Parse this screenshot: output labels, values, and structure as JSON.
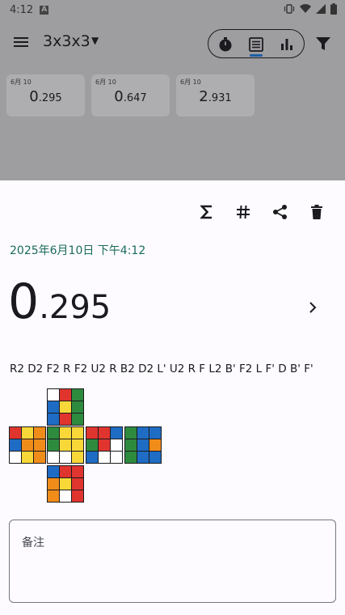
{
  "status_bar": {
    "time": "4:12",
    "notif_letter": "A"
  },
  "top_bar": {
    "puzzle": "3x3x3"
  },
  "history_cards": [
    {
      "date": "6月 10",
      "int": "0",
      "dec": ".295"
    },
    {
      "date": "6月 10",
      "int": "0",
      "dec": ".647"
    },
    {
      "date": "6月 10",
      "int": "2",
      "dec": ".931"
    }
  ],
  "solve": {
    "date": "2025年6月10日 下午4:12",
    "time_int": "0",
    "time_dec": ".295",
    "scramble": "R2 D2 F2 R F2 U2 R B2 D2 L' U2 R F L2 B' F2 L F' D B' F'"
  },
  "cube_colors": {
    "W": "#ffffff",
    "Y": "#f8d838",
    "R": "#e0342f",
    "O": "#f08c1a",
    "G": "#2e8b3e",
    "B": "#1f6cc4"
  },
  "cube_net": {
    "U": [
      "W",
      "R",
      "G",
      "B",
      "Y",
      "G",
      "B",
      "R",
      "G"
    ],
    "L": [
      "R",
      "Y",
      "O",
      "B",
      "O",
      "O",
      "W",
      "Y",
      "O"
    ],
    "F": [
      "G",
      "Y",
      "Y",
      "G",
      "Y",
      "Y",
      "W",
      "W",
      "Y"
    ],
    "R": [
      "R",
      "R",
      "B",
      "G",
      "R",
      "W",
      "B",
      "W",
      "W"
    ],
    "B": [
      "G",
      "B",
      "B",
      "G",
      "B",
      "O",
      "G",
      "B",
      "B"
    ],
    "D": [
      "B",
      "R",
      "R",
      "O",
      "Y",
      "R",
      "O",
      "W",
      "R"
    ]
  },
  "notes": {
    "label": "备注"
  }
}
